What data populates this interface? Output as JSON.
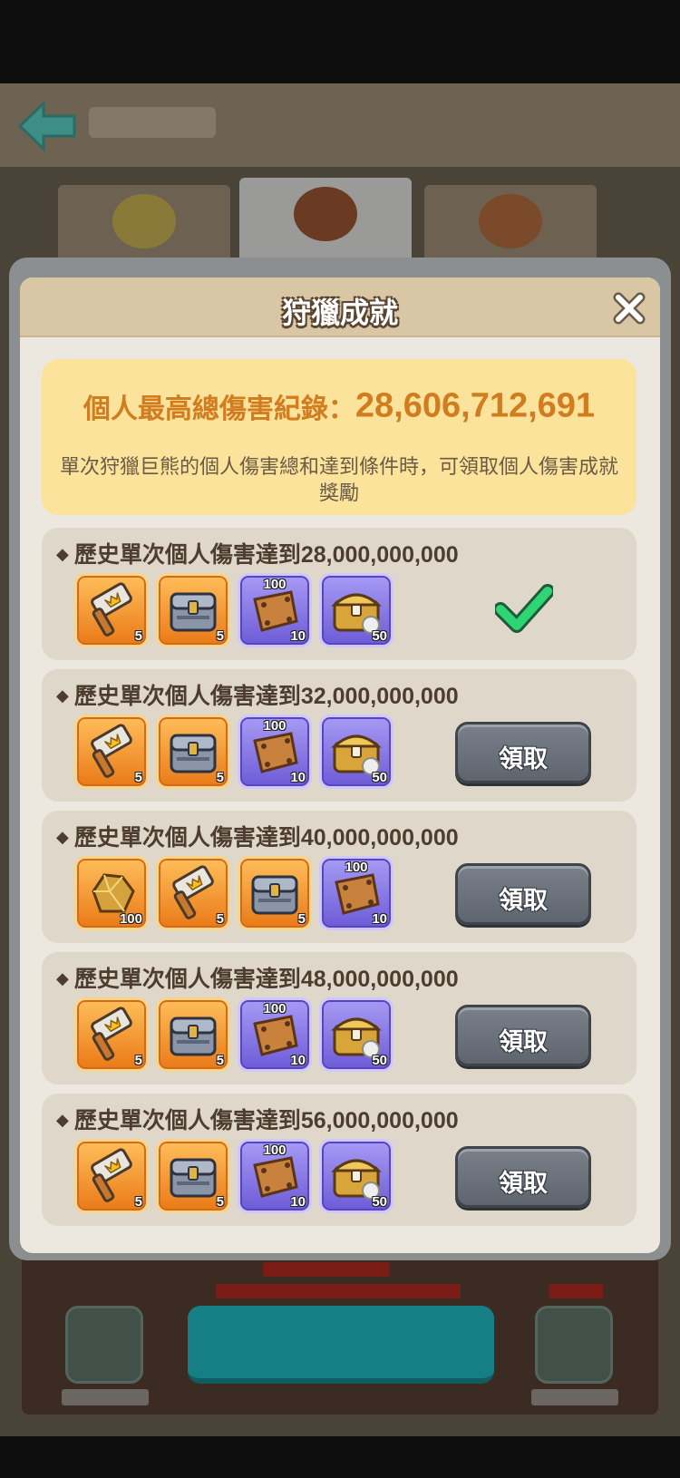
{
  "modal": {
    "title": "狩獵成就",
    "close_icon": "close-icon"
  },
  "record": {
    "label": "個人最高總傷害紀錄：",
    "value": "28,606,712,691",
    "description": "單次狩獵巨熊的個人傷害總和達到條件時，可領取個人傷害成就獎勵"
  },
  "achievements": [
    {
      "title": "歷史單次個人傷害達到28,000,000,000",
      "status": "claimed",
      "rewards": [
        {
          "icon": "hammer-icon",
          "bg": "orange",
          "qty": "5",
          "badge": ""
        },
        {
          "icon": "chest-icon",
          "bg": "orange",
          "qty": "5",
          "badge": ""
        },
        {
          "icon": "leather-icon",
          "bg": "purple",
          "qty": "10",
          "badge": "100"
        },
        {
          "icon": "gold-chest-icon",
          "bg": "purple",
          "qty": "50",
          "badge": ""
        }
      ]
    },
    {
      "title": "歷史單次個人傷害達到32,000,000,000",
      "status": "claimable",
      "button_label": "領取",
      "rewards": [
        {
          "icon": "hammer-icon",
          "bg": "orange",
          "qty": "5",
          "badge": ""
        },
        {
          "icon": "chest-icon",
          "bg": "orange",
          "qty": "5",
          "badge": ""
        },
        {
          "icon": "leather-icon",
          "bg": "purple",
          "qty": "10",
          "badge": "100"
        },
        {
          "icon": "gold-chest-icon",
          "bg": "purple",
          "qty": "50",
          "badge": ""
        }
      ]
    },
    {
      "title": "歷史單次個人傷害達到40,000,000,000",
      "status": "claimable",
      "button_label": "領取",
      "rewards": [
        {
          "icon": "gold-ore-icon",
          "bg": "orange",
          "qty": "100",
          "badge": ""
        },
        {
          "icon": "hammer-icon",
          "bg": "orange",
          "qty": "5",
          "badge": ""
        },
        {
          "icon": "chest-icon",
          "bg": "orange",
          "qty": "5",
          "badge": ""
        },
        {
          "icon": "leather-icon",
          "bg": "purple",
          "qty": "10",
          "badge": "100"
        }
      ]
    },
    {
      "title": "歷史單次個人傷害達到48,000,000,000",
      "status": "claimable",
      "button_label": "領取",
      "rewards": [
        {
          "icon": "hammer-icon",
          "bg": "orange",
          "qty": "5",
          "badge": ""
        },
        {
          "icon": "chest-icon",
          "bg": "orange",
          "qty": "5",
          "badge": ""
        },
        {
          "icon": "leather-icon",
          "bg": "purple",
          "qty": "10",
          "badge": "100"
        },
        {
          "icon": "gold-chest-icon",
          "bg": "purple",
          "qty": "50",
          "badge": ""
        }
      ]
    },
    {
      "title": "歷史單次個人傷害達到56,000,000,000",
      "status": "claimable",
      "button_label": "領取",
      "rewards": [
        {
          "icon": "hammer-icon",
          "bg": "orange",
          "qty": "5",
          "badge": ""
        },
        {
          "icon": "chest-icon",
          "bg": "orange",
          "qty": "5",
          "badge": ""
        },
        {
          "icon": "leather-icon",
          "bg": "purple",
          "qty": "10",
          "badge": "100"
        },
        {
          "icon": "gold-chest-icon",
          "bg": "purple",
          "qty": "50",
          "badge": ""
        }
      ]
    }
  ],
  "colors": {
    "record_text": "#d27c20",
    "check": "#2ed573"
  }
}
